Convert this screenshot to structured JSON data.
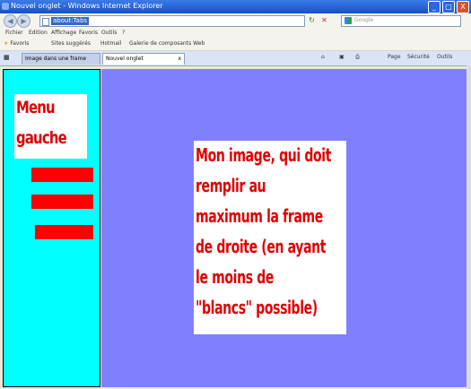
{
  "window": {
    "title": "Nouvel onglet - Windows Internet Explorer",
    "minimize": "_",
    "maximize": "□",
    "close": "X"
  },
  "toolbar": {
    "back": "◀",
    "forward": "▶",
    "address": "about:Tabs",
    "search_placeholder": "Google",
    "refresh": "↻",
    "stop": "✕"
  },
  "menu": {
    "items": [
      "Fichier",
      "Edition",
      "Affichage",
      "Favoris",
      "Outils",
      "?"
    ]
  },
  "favorites": {
    "items": [
      "Favoris",
      "Sites suggérés",
      "Hotmail",
      "Galerie de composants Web"
    ]
  },
  "tabs": {
    "items": [
      "Image dans une frame",
      "Nouvel onglet"
    ],
    "close": "x",
    "tools": [
      "Page",
      "Sécurité",
      "Outils"
    ]
  },
  "page": {
    "left_menu": {
      "line1": "Menu",
      "line2": "gauche"
    },
    "image_text": [
      "Mon image, qui doit",
      "remplir au",
      "maximum la frame",
      "de droite (en ayant",
      "le moins de",
      "\"blancs\" possible)"
    ]
  },
  "colors": {
    "left_frame": "#00FFFF",
    "right_frame": "#8080FF",
    "red_text": "#E00000",
    "red_bars": "#FF0000"
  }
}
